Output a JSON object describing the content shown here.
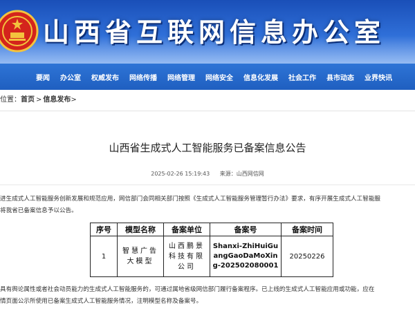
{
  "header": {
    "site_title": "山西省互联网信息办公室"
  },
  "nav": {
    "items": [
      "要闻",
      "办公室",
      "权威发布",
      "网络传播",
      "网络管理",
      "网络安全",
      "信息化发展",
      "社会工作",
      "县市动态",
      "业界快讯"
    ]
  },
  "breadcrumb": {
    "prefix": "位置：",
    "home": "首页",
    "sep": ">",
    "section": "信息发布",
    "trail": ">"
  },
  "article": {
    "title": "山西省生成式人工智能服务已备案信息公告",
    "date": "2025-02-26 15:19:43",
    "source": "来源：山西网信网",
    "paragraph1_line1": "进生成式人工智能服务创新发展和规范应用，网信部门会同相关部门按照《生成式人工智能服务管理暂行办法》要求，有序开展生成式人工智能服",
    "paragraph1_line2": "将我省已备案信息予以公告。",
    "paragraph2_line1": "具有舆论属性或者社会动员能力的生成式人工智能服务的，可通过属地省级网信部门履行备案程序。已上线的生成式人工智能应用或功能，应在",
    "paragraph2_line2": "情页面公示所使用已备案生成式人工智能服务情况，注明模型名称及备案号。"
  },
  "table": {
    "headers": [
      "序号",
      "模型名称",
      "备案单位",
      "备案号",
      "备案时间"
    ],
    "rows": [
      {
        "no": "1",
        "model": "智慧广告大模型",
        "unit": "山西鹏景科技有限公司",
        "reg": "Shanxi-ZhiHuiGuangGaoDaMoXing-202502080001",
        "time": "20250226"
      }
    ]
  },
  "colors": {
    "banner_top": "#1a4fb8",
    "banner_bottom": "#5d97ec",
    "nav": "#2468cc"
  }
}
